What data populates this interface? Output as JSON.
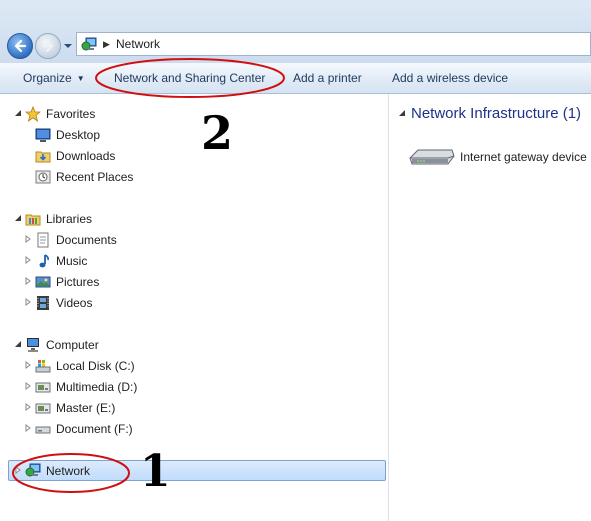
{
  "address_bar": {
    "location": "Network"
  },
  "command_bar": {
    "organize": "Organize",
    "network_sharing_center": "Network and Sharing Center",
    "add_printer": "Add a printer",
    "add_wireless": "Add a wireless device"
  },
  "nav_pane": {
    "favorites": {
      "label": "Favorites",
      "items": [
        "Desktop",
        "Downloads",
        "Recent Places"
      ]
    },
    "libraries": {
      "label": "Libraries",
      "items": [
        "Documents",
        "Music",
        "Pictures",
        "Videos"
      ]
    },
    "computer": {
      "label": "Computer",
      "items": [
        "Local Disk (C:)",
        "Multimedia (D:)",
        "Master (E:)",
        "Document (F:)"
      ]
    },
    "network": {
      "label": "Network",
      "selected": true
    }
  },
  "content": {
    "group_header": "Network Infrastructure (1)",
    "device": "Internet gateway device"
  },
  "annotations": {
    "mark_1": "1",
    "mark_2": "2"
  },
  "colors": {
    "accent_blue": "#1e3287",
    "selection": "#c1dcfc",
    "annotation_red": "#d01010"
  }
}
